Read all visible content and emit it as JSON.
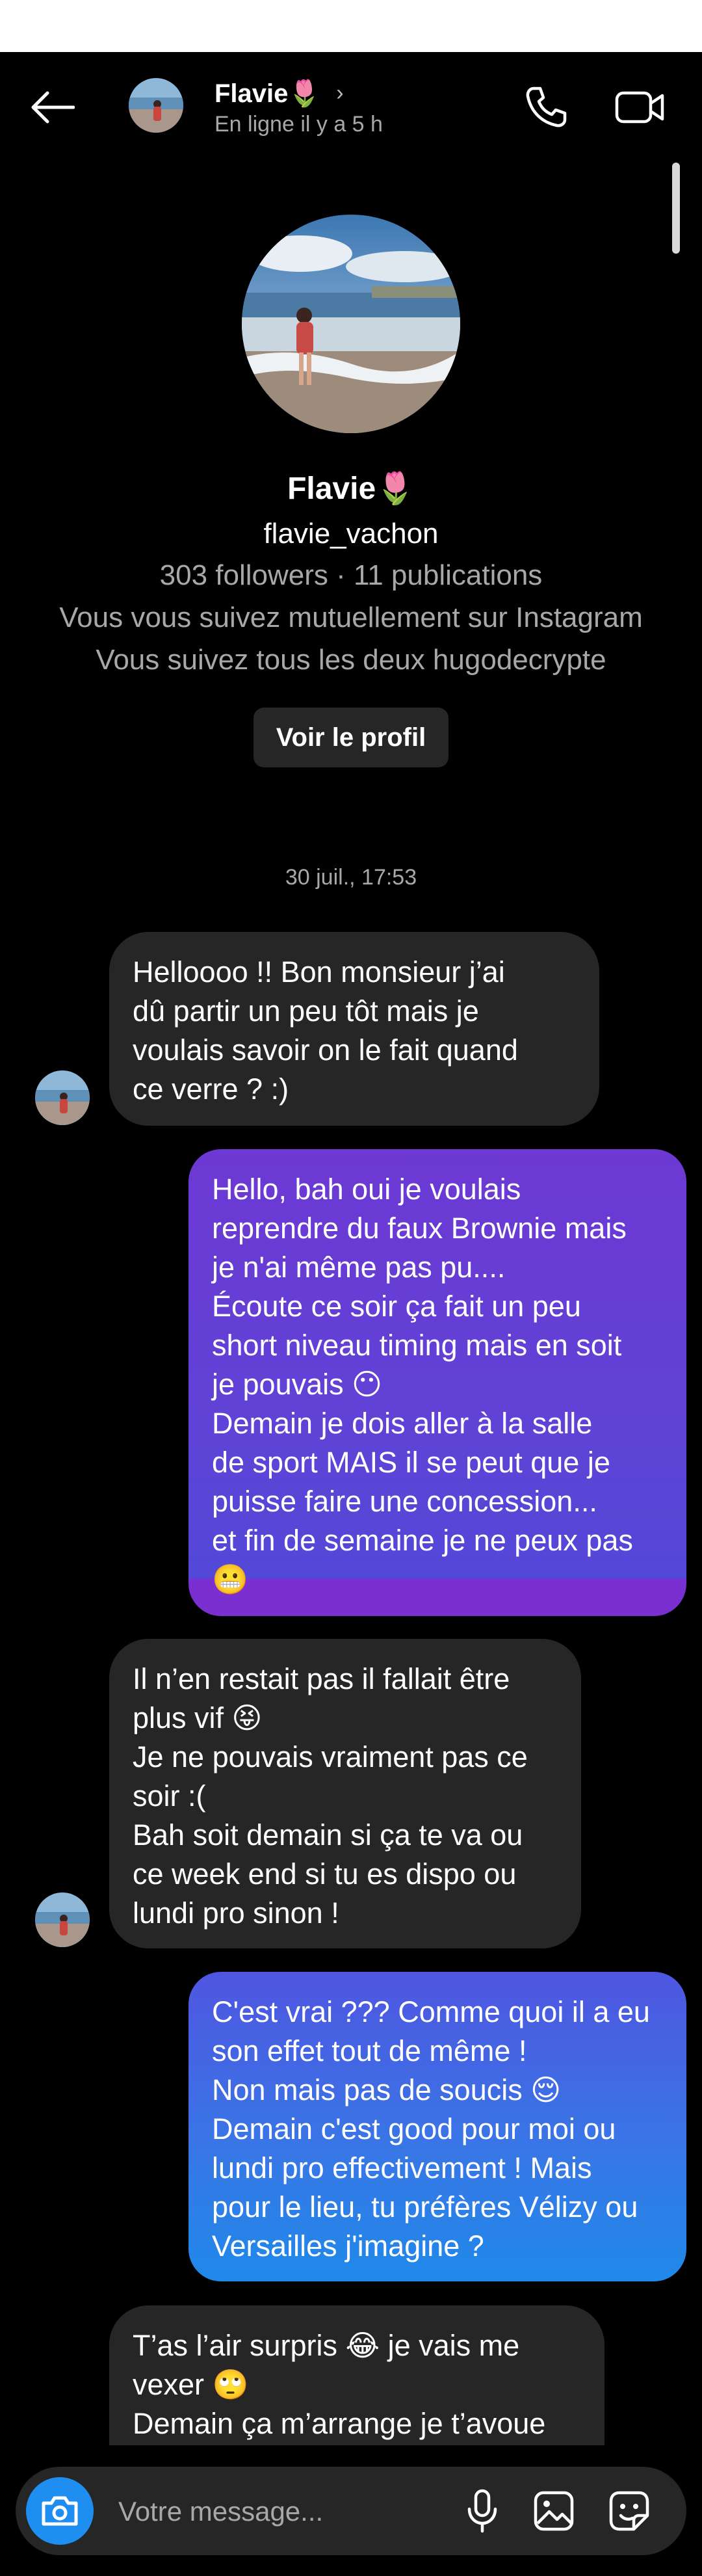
{
  "header": {
    "name": "Flavie🌷",
    "chevron": "›",
    "status": "En ligne il y a 5 h",
    "icons": {
      "back": "back-arrow-icon",
      "call": "phone-icon",
      "video": "video-camera-icon"
    }
  },
  "profile": {
    "name": "Flavie🌷",
    "username": "flavie_vachon",
    "stats": "303 followers · 11 publications",
    "mutual": "Vous vous suivez mutuellement sur Instagram",
    "common": "Vous suivez tous les deux hugodecrypte",
    "view_profile_label": "Voir le profil"
  },
  "thread": {
    "timestamp": "30 juil., 17:53",
    "messages": [
      {
        "from": "them",
        "text": "Helloooo !! Bon monsieur j’ai\ndû partir un peu tôt mais je\nvoulais savoir on le fait quand\nce verre ? :)"
      },
      {
        "from": "me",
        "text": "Hello, bah oui je voulais\nreprendre du faux Brownie mais\nje n'ai même pas pu....\nÉcoute ce soir ça fait un peu\nshort niveau timing mais en soit\nje pouvais 😶\nDemain je dois aller à la salle\nde sport MAIS il se peut que je\npuisse faire une concession...\net fin de semaine je ne peux pas\n😬"
      },
      {
        "from": "them",
        "text": "Il n’en restait pas il fallait être\nplus vif 😝\nJe ne pouvais vraiment pas ce\nsoir :(\nBah soit demain si ça te va ou\nce week end si tu es dispo ou\nlundi pro sinon !"
      },
      {
        "from": "me",
        "text": "C'est vrai ??? Comme quoi il a eu\nson effet tout de même !\nNon mais pas de soucis 😌\nDemain c'est good pour moi ou\nlundi pro effectivement ! Mais\npour le lieu, tu préfères Vélizy ou\nVersailles j'imagine ?"
      },
      {
        "from": "them",
        "text": "T’as l’air surpris 😂 je vais me\nvexer 🙄\nDemain ça m’arrange je t’avoue\net après pour le lieu Paris ça me"
      }
    ]
  },
  "composer": {
    "placeholder": "Votre message...",
    "icons": {
      "camera": "camera-icon",
      "mic": "microphone-icon",
      "gallery": "image-icon",
      "sticker": "sticker-icon"
    }
  },
  "colors": {
    "background": "#000000",
    "incoming_bubble": "#262626",
    "outgoing_gradient_top": "#6d38d3",
    "outgoing_gradient_bottom": "#1f89ea",
    "camera_button": "#1f8ef1",
    "secondary_text": "#a8a8a8"
  }
}
